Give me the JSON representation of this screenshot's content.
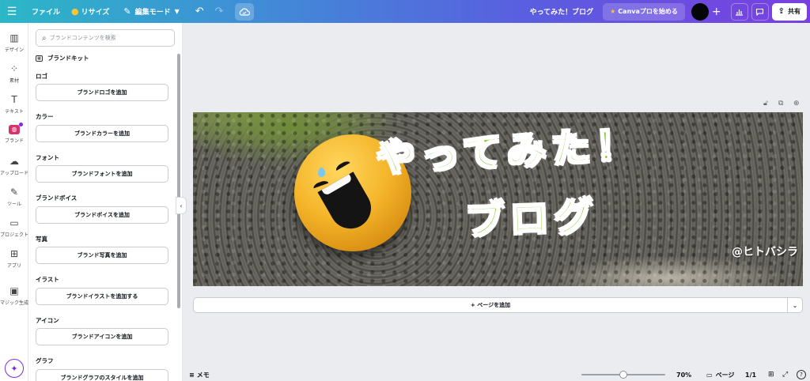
{
  "topbar": {
    "menu_icon": "hamburger-icon",
    "file_label": "ファイル",
    "resize_label": "リサイズ",
    "edit_mode_label": "編集モード",
    "doc_title": "やってみた！ブログ",
    "pro_label": "Canvaプロを始める",
    "share_label": "共有",
    "gradient": [
      "#2bb7c7",
      "#3f8fd6",
      "#5a5ee0",
      "#7a3fe0"
    ]
  },
  "rail": {
    "items": [
      {
        "label": "デザイン",
        "icon": "layout-icon"
      },
      {
        "label": "素材",
        "icon": "shapes-icon"
      },
      {
        "label": "テキスト",
        "icon": "text-icon"
      },
      {
        "label": "ブランド",
        "icon": "brand-icon",
        "active": true
      },
      {
        "label": "アップロード",
        "icon": "cloud-upload-icon"
      },
      {
        "label": "ツール",
        "icon": "pen-tool-icon"
      },
      {
        "label": "プロジェクト",
        "icon": "folder-icon"
      },
      {
        "label": "アプリ",
        "icon": "apps-icon"
      },
      {
        "label": "マジック生成",
        "icon": "magic-image-icon"
      }
    ]
  },
  "panel": {
    "search_placeholder": "ブランドコンテンツを検索",
    "kit_label": "ブランドキット",
    "sections": [
      {
        "title": "ロゴ",
        "button": "ブランドロゴを追加"
      },
      {
        "title": "カラー",
        "button": "ブランドカラーを追加"
      },
      {
        "title": "フォント",
        "button": "ブランドフォントを追加"
      },
      {
        "title": "ブランドボイス",
        "button": "ブランドボイスを追加"
      },
      {
        "title": "写真",
        "button": "ブランド写真を追加"
      },
      {
        "title": "イラスト",
        "button": "ブランドイラストを追加する"
      },
      {
        "title": "アイコン",
        "button": "ブランドアイコンを追加"
      },
      {
        "title": "グラフ",
        "button": "ブランドグラフのスタイルを追加"
      }
    ]
  },
  "design": {
    "title_line1": "やってみた！",
    "title_line2": "ブログ",
    "handle": "@ヒトバシラ",
    "title_color": "#7dc623"
  },
  "canvas": {
    "add_page_label": "+ ページを追加"
  },
  "bottombar": {
    "notes_label": "メモ",
    "zoom_label": "70%",
    "zoom_value": 70,
    "pages_label": "ページ",
    "page_count": "1/1"
  }
}
